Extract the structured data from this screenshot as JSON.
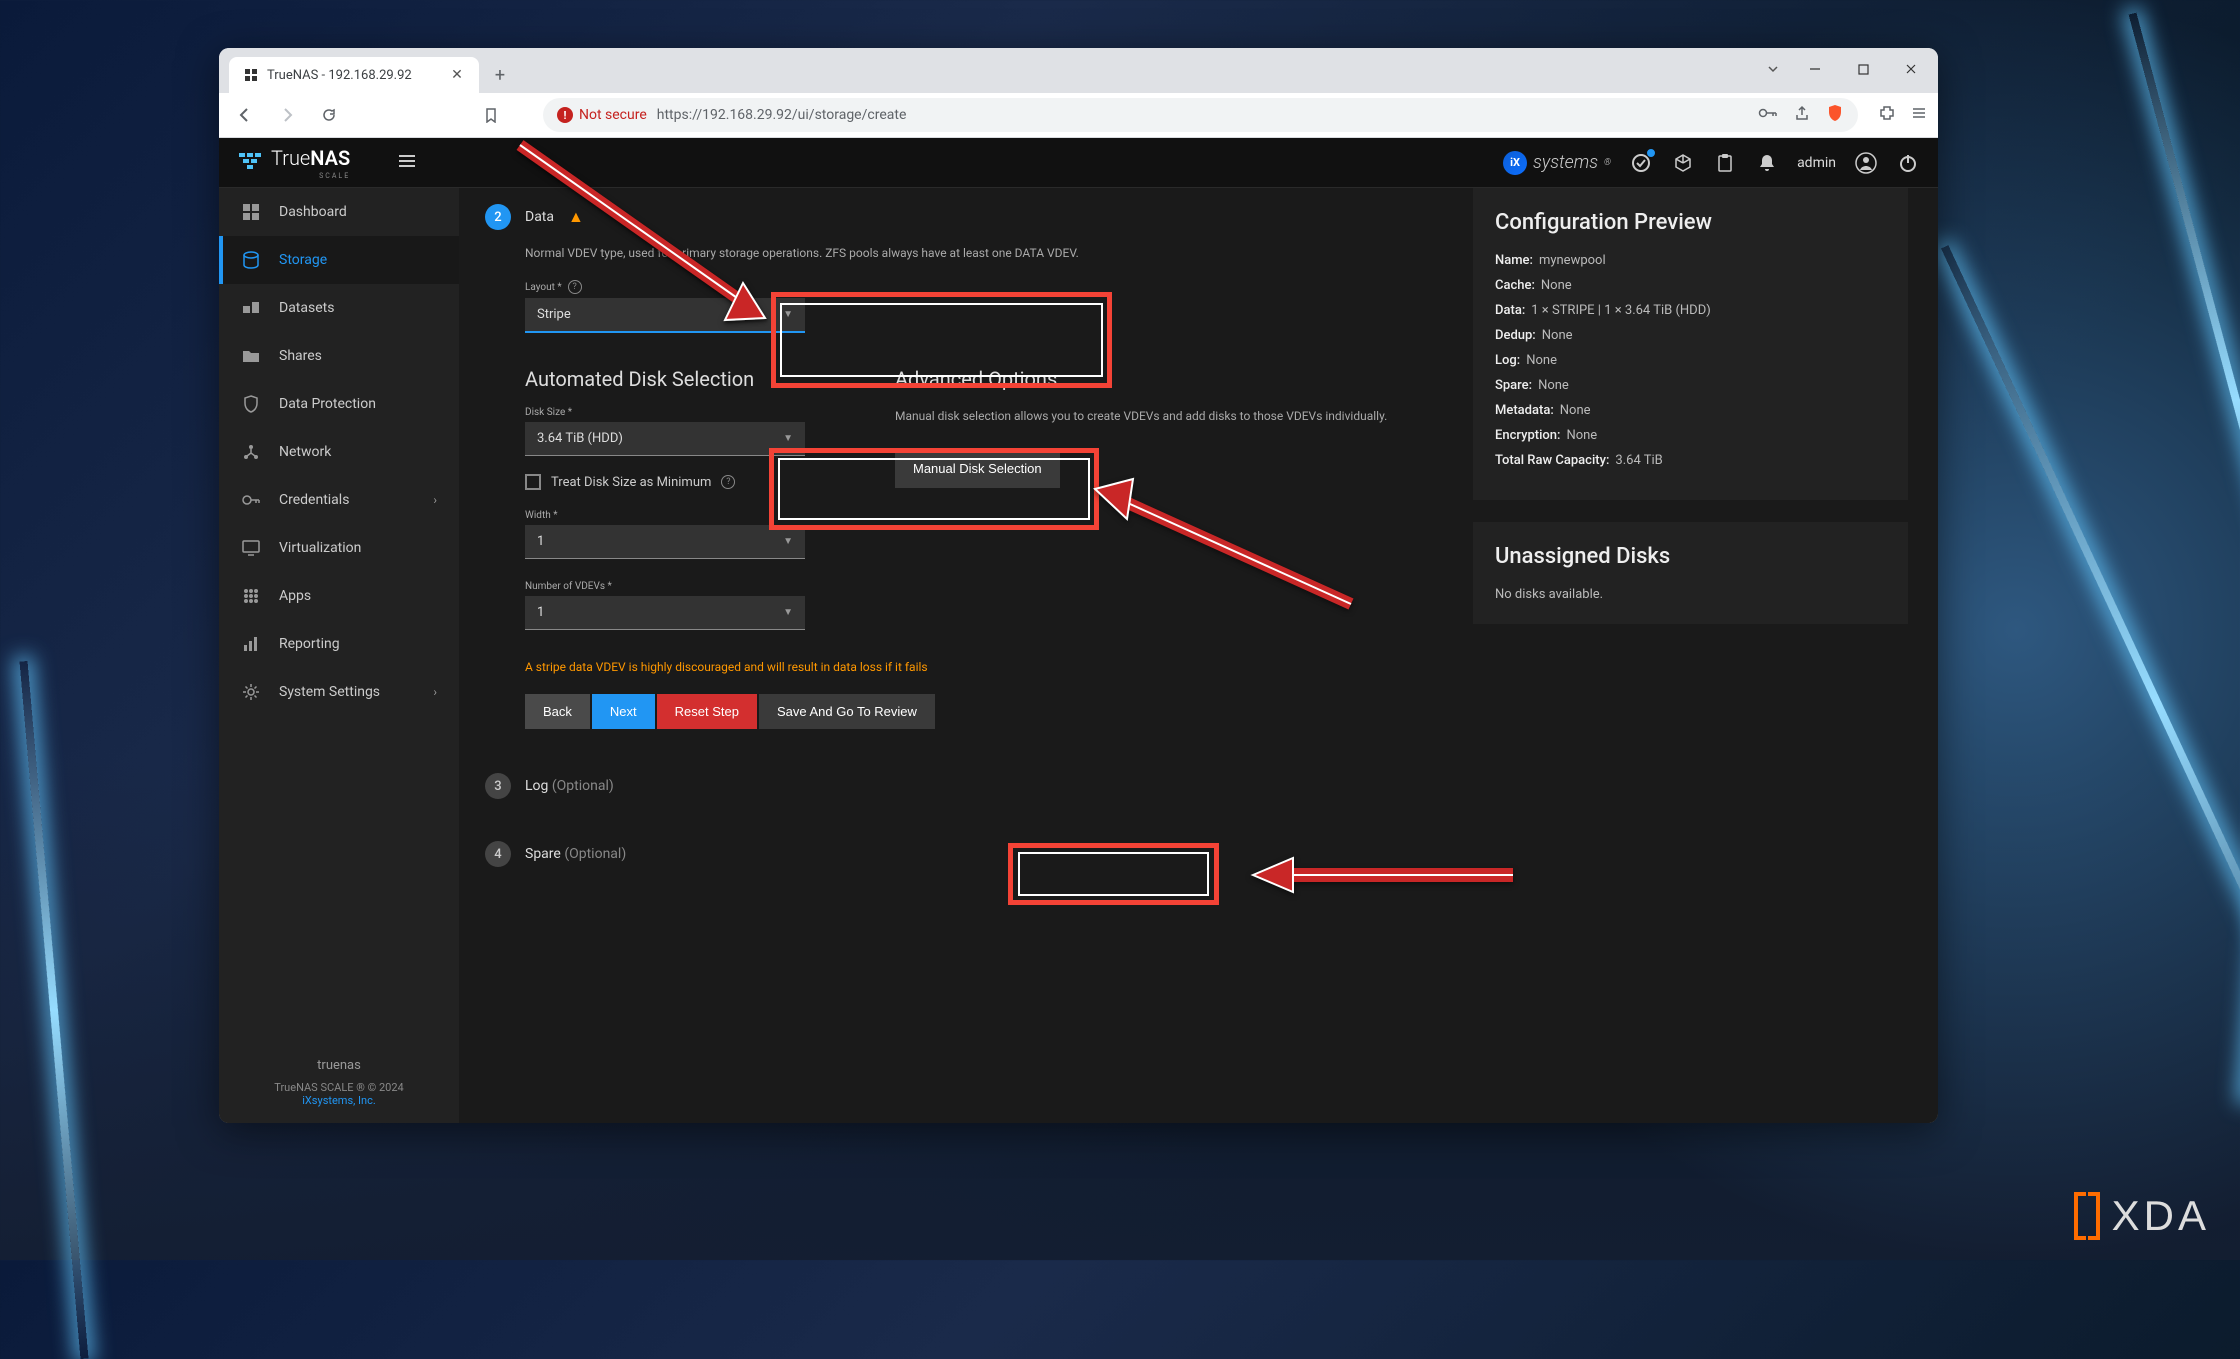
{
  "browser": {
    "tab_title": "TrueNAS - 192.168.29.92",
    "not_secure": "Not secure",
    "url_scheme": "https",
    "url_rest": "://192.168.29.92/ui/storage/create"
  },
  "topbar": {
    "logo_true": "True",
    "logo_nas": "NAS",
    "logo_sub": "SCALE",
    "ixsystems": "systems",
    "user": "admin"
  },
  "sidebar": {
    "items": [
      {
        "icon": "dashboard",
        "label": "Dashboard"
      },
      {
        "icon": "storage",
        "label": "Storage"
      },
      {
        "icon": "datasets",
        "label": "Datasets"
      },
      {
        "icon": "shares",
        "label": "Shares"
      },
      {
        "icon": "shield",
        "label": "Data Protection"
      },
      {
        "icon": "network",
        "label": "Network"
      },
      {
        "icon": "key",
        "label": "Credentials",
        "expand": true
      },
      {
        "icon": "monitor",
        "label": "Virtualization"
      },
      {
        "icon": "apps",
        "label": "Apps"
      },
      {
        "icon": "chart",
        "label": "Reporting"
      },
      {
        "icon": "gear",
        "label": "System Settings",
        "expand": true
      }
    ],
    "footer": {
      "host": "truenas",
      "version": "TrueNAS SCALE ® © 2024",
      "company": "iXsystems, Inc."
    }
  },
  "step2": {
    "num": "2",
    "title": "Data",
    "desc": "Normal VDEV type, used for primary storage operations. ZFS pools always have at least one DATA VDEV.",
    "layout_label": "Layout *",
    "layout_value": "Stripe",
    "auto_title": "Automated Disk Selection",
    "disk_size_label": "Disk Size *",
    "disk_size_value": "3.64 TiB (HDD)",
    "treat_min": "Treat Disk Size as Minimum",
    "width_label": "Width *",
    "width_value": "1",
    "vdevs_label": "Number of VDEVs *",
    "vdevs_value": "1",
    "adv_title": "Advanced Options",
    "adv_desc": "Manual disk selection allows you to create VDEVs and add disks to those VDEVs individually.",
    "manual_btn": "Manual Disk Selection",
    "warning": "A stripe data VDEV is highly discouraged and will result in data loss if it fails"
  },
  "buttons": {
    "back": "Back",
    "next": "Next",
    "reset": "Reset Step",
    "save_review": "Save And Go To Review"
  },
  "step3": {
    "num": "3",
    "title": "Log",
    "opt": "(Optional)"
  },
  "step4": {
    "num": "4",
    "title": "Spare",
    "opt": "(Optional)"
  },
  "config": {
    "title": "Configuration Preview",
    "rows": [
      {
        "label": "Name:",
        "value": "mynewpool"
      },
      {
        "label": "Cache:",
        "value": "None"
      },
      {
        "label": "Data:",
        "value": "1 × STRIPE | 1 × 3.64 TiB (HDD)"
      },
      {
        "label": "Dedup:",
        "value": "None"
      },
      {
        "label": "Log:",
        "value": "None"
      },
      {
        "label": "Spare:",
        "value": "None"
      },
      {
        "label": "Metadata:",
        "value": "None"
      },
      {
        "label": "Encryption:",
        "value": "None"
      },
      {
        "label": "Total Raw Capacity:",
        "value": "3.64 TiB"
      }
    ]
  },
  "unassigned": {
    "title": "Unassigned Disks",
    "none": "No disks available."
  },
  "xda": "XDA"
}
